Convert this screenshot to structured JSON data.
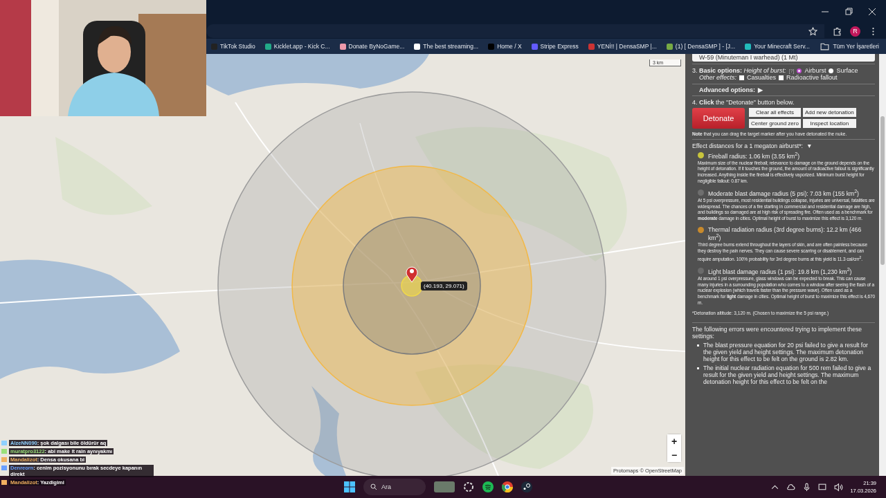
{
  "browser": {
    "profile_initial": "R",
    "bookmarks": [
      "TikTok Studio",
      "Kicklet.app - Kick C...",
      "Donate ByNoGame...",
      "The best streaming...",
      "Home / X",
      "Stripe Express",
      "YENİ!! | DensaSMP |...",
      "(1) [ DensaSMP ] - [J...",
      "Your Minecraft Serv..."
    ],
    "all_bookmarks": "Tüm Yer İşaretleri"
  },
  "map": {
    "scale": "3 km",
    "coordinates": "(40.193, 29.071)",
    "zoom_in": "+",
    "zoom_out": "−",
    "attribution": "Protomaps © OpenStreetMap",
    "rings": [
      {
        "kind": "light_blast",
        "color": "#9c9c9c"
      },
      {
        "kind": "thermal",
        "color": "#f2b846"
      },
      {
        "kind": "moderate_blast",
        "color": "#7c7c7c"
      },
      {
        "kind": "fireball",
        "color": "#f0d84a"
      }
    ]
  },
  "panel": {
    "warhead": "W-59 (Minuteman I warhead) (1 Mt)",
    "basic_label": "3. **Basic options:** *Height of burst:*",
    "help": "[?]",
    "burst": [
      {
        "label": "Airburst",
        "selected": true
      },
      {
        "label": "Surface",
        "selected": false
      }
    ],
    "other_label": "Other effects:",
    "other_effects": [
      {
        "label": "Casualties",
        "checked": false
      },
      {
        "label": "Radioactive fallout",
        "checked": false
      }
    ],
    "advanced": "Advanced options:",
    "advanced_arrow": "▶",
    "step4": "4. **Click** the \"Detonate\" button below.",
    "detonate": "Detonate",
    "buttons": [
      "Clear all effects",
      "Add new detonation",
      "Center ground zero",
      "Inspect location"
    ],
    "note": "**Note** that you can drag the target marker after you have detonated the nuke.",
    "effects_heading": "Effect distances for a 1 megaton airburst*:",
    "effects_arrow": "▼",
    "effects": [
      {
        "title": "Fireball radius: 1.06 km (3.55 km$^{2}$)",
        "color": "#c8c43c",
        "description": "Maximum size of the nuclear fireball; relevance to damage on the ground depends on the height of detonation. If it touches the ground, the amount of radioactive fallout is significantly increased. Anything inside the fireball is effectively vaporized. Minimum burst height for negligible fallout: 0.87 km."
      },
      {
        "title": "Moderate blast damage radius (5 psi): 7.03 km (155 km$^{2}$)",
        "color": "#6e6e6e",
        "description": "At 5 psi overpressure, most residential buildings collapse, injuries are universal, fatalities are widespread. The chances of a fire starting in commercial and residential damage are high, and buildings so damaged are at high risk of spreading fire. Often used as a benchmark for **moderate** damage in cities. Optimal height of burst to maximize this effect is 3,120 m."
      },
      {
        "title": "Thermal radiation radius (3rd degree burns): 12.2 km (466 km$^{2}$)",
        "color": "#c88a2c",
        "description": "Third degree burns extend throughout the layers of skin, and are often painless because they destroy the pain nerves. They can cause severe scarring or disablement, and can require amputation. 100% probability for 3rd degree burns at this yield is 11.3 cal/cm$^{2}$."
      },
      {
        "title": "Light blast damage radius (1 psi): 19.8 km (1,230 km$^{2}$)",
        "color": "#6a6a6a",
        "description": "At around 1 psi overpressure, glass windows can be expected to break. This can cause many injuries in a surrounding population who comes to a window after seeing the flash of a nuclear explosion (which travels faster than the pressure wave). Often used as a benchmark for **light** damage in cities. Optimal height of burst to maximize this effect is 4,670 m."
      }
    ],
    "footnote": "*Detonation altitude: 3,120 m. (Chosen to maximize the 5 psi range.)",
    "errors_intro": "The following errors were encountered trying to implement these settings:",
    "errors": [
      "The blast pressure equation for 20 psi failed to give a result for the given yield and height settings. The maximum detonation height for this effect to be felt on the ground is 2.82 km.",
      "The initial nuclear radiation equation for 500 rem failed to give a result for the given yield and height settings. The maximum detonation height for this effect to be felt on the"
    ]
  },
  "chat": [
    {
      "user": "AlzeNN090",
      "text": ": şok dalgası bile öldürür aq",
      "color": "#8fd0ff"
    },
    {
      "user": "muratpro3122",
      "text": ": abi make it rain aynıyakmı",
      "color": "#9be07a"
    },
    {
      "user": "Mandalizot",
      "text": ": Densa okusana bi",
      "color": "#f0b060"
    },
    {
      "user": "Denreorn",
      "text": ": cenim pozisyonunu bırak secdeye kapanın direkt",
      "color": "#6aa0ff"
    },
    {
      "user": "Mandalizot",
      "text": ": Yazdigimi",
      "color": "#f0b060"
    }
  ],
  "taskbar": {
    "search": "Ara",
    "time": "21:39",
    "date": "17.03.2026"
  }
}
